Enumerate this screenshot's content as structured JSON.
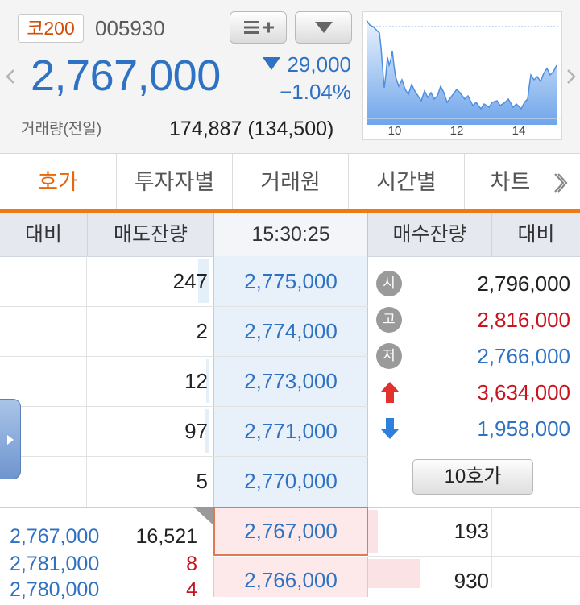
{
  "header": {
    "badge": "코200",
    "code": "005930",
    "price": "2,767,000",
    "change_abs": "29,000",
    "change_pct": "−1.04%",
    "volume_label": "거래량(전일)",
    "volume_value": "174,887 (134,500)"
  },
  "mini_chart": {
    "x_ticks": [
      "10",
      "12",
      "14"
    ],
    "color": "#4f8fe0"
  },
  "tabs": [
    "호가",
    "투자자별",
    "거래원",
    "시간별",
    "차트"
  ],
  "columns": {
    "left_diff": "대비",
    "ask_qty": "매도잔량",
    "time": "15:30:25",
    "bid_qty": "매수잔량",
    "right_diff": "대비"
  },
  "asks": [
    {
      "qty": "247",
      "price": "2,775,000"
    },
    {
      "qty": "2",
      "price": "2,774,000"
    },
    {
      "qty": "12",
      "price": "2,773,000"
    },
    {
      "qty": "97",
      "price": "2,771,000"
    },
    {
      "qty": "5",
      "price": "2,770,000"
    }
  ],
  "info": [
    {
      "label": "시",
      "value": "2,796,000",
      "color": "#222222"
    },
    {
      "label": "고",
      "value": "2,816,000",
      "color": "#c8141e"
    },
    {
      "label": "저",
      "value": "2,766,000",
      "color": "#2f72c3"
    },
    {
      "label": "up-arrow",
      "value": "3,634,000",
      "color": "#c8141e"
    },
    {
      "label": "down-arrow",
      "value": "1,958,000",
      "color": "#2f72c3"
    }
  ],
  "ten_button": "10호가",
  "trades": [
    {
      "price": "2,767,000",
      "qty": "16,521",
      "qty_color": "#222222"
    },
    {
      "price": "2,781,000",
      "qty": "8",
      "qty_color": "#c8141e"
    },
    {
      "price": "2,780,000",
      "qty": "4",
      "qty_color": "#c8141e"
    }
  ],
  "current_price": "2,767,000",
  "bids": [
    {
      "price": "2,767,000",
      "qty": "193"
    },
    {
      "price": "2,766,000",
      "qty": "930"
    }
  ]
}
